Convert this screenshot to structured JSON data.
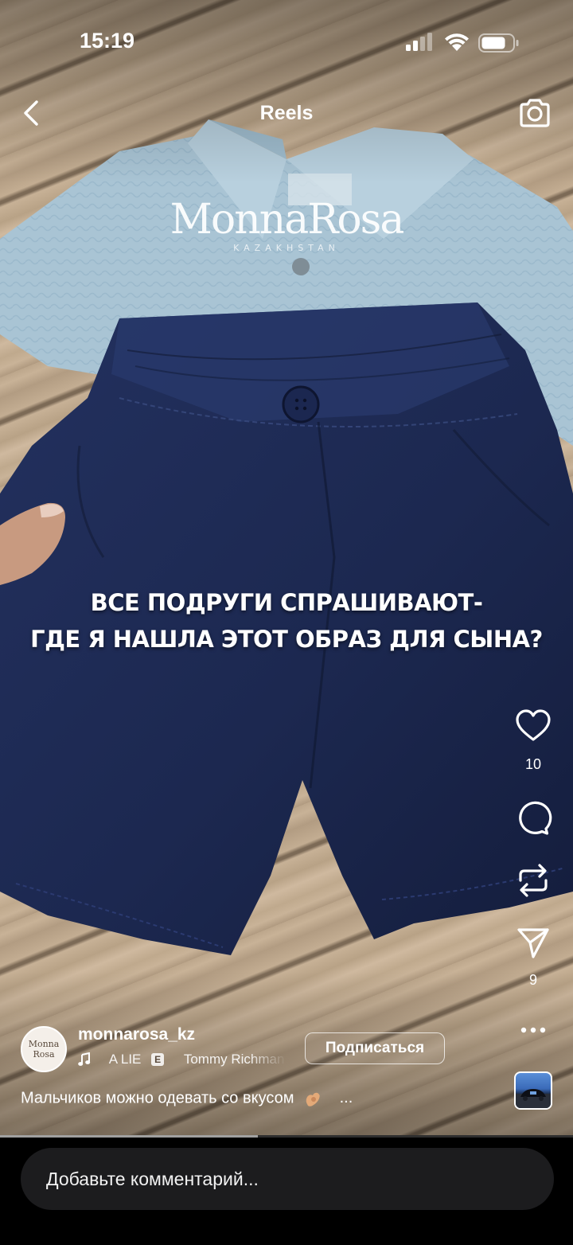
{
  "status_bar": {
    "time": "15:19"
  },
  "header": {
    "title": "Reels"
  },
  "video": {
    "watermark_brand": "MonnaRosa",
    "watermark_sub": "KAZAKHSTAN",
    "overlay_line_1": "ВСЕ ПОДРУГИ СПРАШИВАЮТ-",
    "overlay_line_2": "ГДЕ Я НАШЛА ЭТОТ ОБРАЗ ДЛЯ СЫНА?",
    "progress": 0.45
  },
  "actions": {
    "likes": "10",
    "shares": "9"
  },
  "author": {
    "username": "monnarosa_kz",
    "avatar_text": [
      "Monna",
      "Rosa"
    ],
    "follow_label": "Подписаться"
  },
  "music": {
    "track": "A LIE",
    "explicit": "E",
    "artist": "Tommy Richman"
  },
  "caption": {
    "text": "Мальчиков можно одевать со вкусом",
    "more": "..."
  },
  "comment": {
    "placeholder": "Добавьте комментарий..."
  },
  "icons": {
    "back": "chevron-left-icon",
    "camera": "camera-icon",
    "like": "heart-icon",
    "comment": "comment-bubble-icon",
    "repost": "repost-icon",
    "share": "send-icon",
    "more": "more-dots-icon",
    "music": "music-note-icon"
  },
  "colors": {
    "overlay_text": "#ffffff",
    "bottom_bar": "#000000",
    "comment_field": "#1c1c1e"
  }
}
